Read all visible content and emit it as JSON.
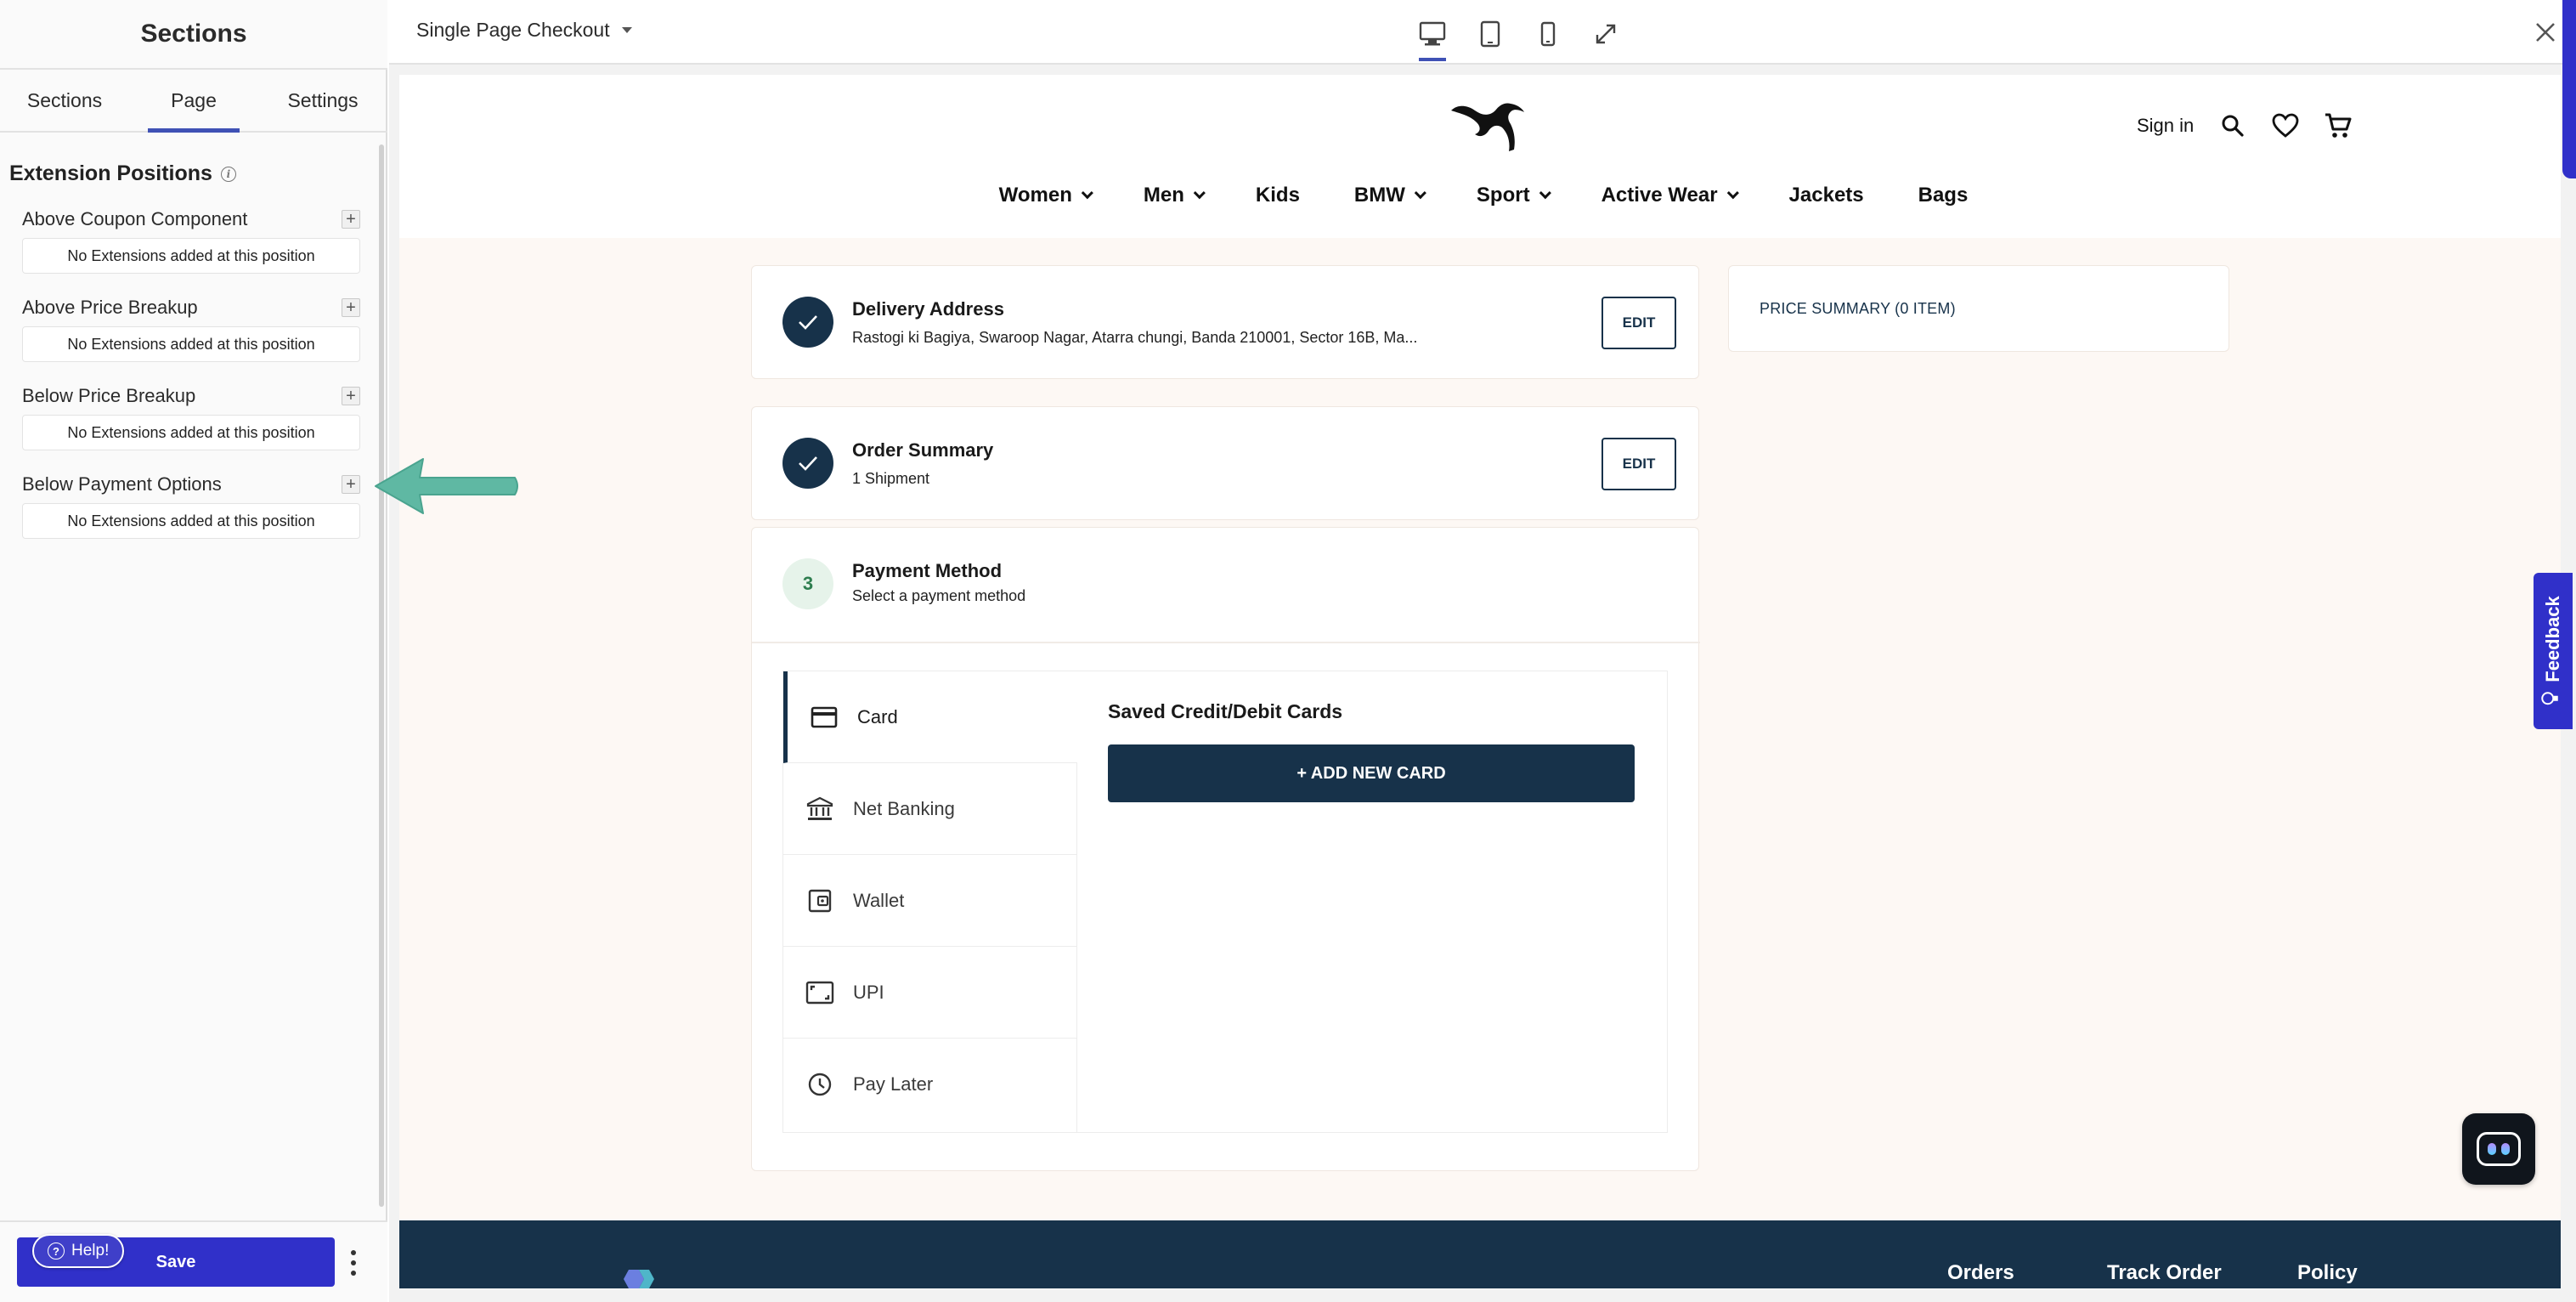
{
  "panel": {
    "title": "Sections",
    "tabs": [
      {
        "label": "Sections",
        "active": false
      },
      {
        "label": "Page",
        "active": true
      },
      {
        "label": "Settings",
        "active": false
      }
    ],
    "extension_heading": "Extension Positions",
    "positions": [
      {
        "label": "Above Coupon Component",
        "empty_text": "No Extensions added at this position"
      },
      {
        "label": "Above Price Breakup",
        "empty_text": "No Extensions added at this position"
      },
      {
        "label": "Below Price Breakup",
        "empty_text": "No Extensions added at this position"
      },
      {
        "label": "Below Payment Options",
        "empty_text": "No Extensions added at this position"
      }
    ],
    "save_label": "Save",
    "help_label": "Help!"
  },
  "topbar": {
    "page_name": "Single Page Checkout",
    "active_device": "desktop"
  },
  "site": {
    "header": {
      "sign_in": "Sign in",
      "nav": [
        {
          "label": "Women",
          "dropdown": true
        },
        {
          "label": "Men",
          "dropdown": true
        },
        {
          "label": "Kids",
          "dropdown": false
        },
        {
          "label": "BMW",
          "dropdown": true
        },
        {
          "label": "Sport",
          "dropdown": true
        },
        {
          "label": "Active Wear",
          "dropdown": true
        },
        {
          "label": "Jackets",
          "dropdown": false
        },
        {
          "label": "Bags",
          "dropdown": false
        }
      ]
    },
    "delivery": {
      "title": "Delivery Address",
      "address": "Rastogi ki Bagiya, Swaroop Nagar, Atarra chungi, Banda 210001, Sector 16B, Ma...",
      "edit_label": "EDIT"
    },
    "order_summary": {
      "title": "Order Summary",
      "subtitle": "1 Shipment",
      "edit_label": "EDIT"
    },
    "payment": {
      "step_number": "3",
      "title": "Payment Method",
      "subtitle": "Select a payment method",
      "methods": [
        {
          "label": "Card",
          "icon": "card-icon",
          "active": true
        },
        {
          "label": "Net Banking",
          "icon": "bank-icon",
          "active": false
        },
        {
          "label": "Wallet",
          "icon": "wallet-icon",
          "active": false
        },
        {
          "label": "UPI",
          "icon": "upi-icon",
          "active": false
        },
        {
          "label": "Pay Later",
          "icon": "clock-icon",
          "active": false
        }
      ],
      "saved_cards_title": "Saved Credit/Debit Cards",
      "add_card_label": "+ ADD NEW CARD"
    },
    "price_summary_label": "PRICE SUMMARY (0 ITEM)",
    "footer_links": [
      "Orders",
      "Track Order",
      "Policy"
    ]
  },
  "feedback_label": "Feedback",
  "colors": {
    "accent": "#3030c9",
    "navy": "#17324a",
    "checkout_bg": "#fdf8f4",
    "arrow": "#5fb8a3"
  }
}
